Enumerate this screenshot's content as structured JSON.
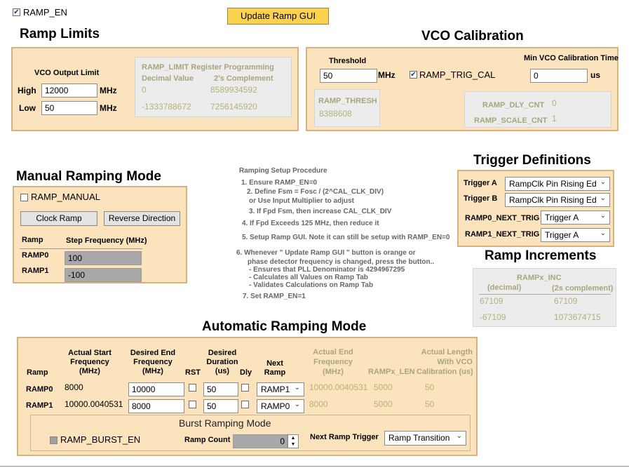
{
  "top": {
    "ramp_en_label": "RAMP_EN",
    "ramp_en_checked": true,
    "update_button": "Update Ramp GUI",
    "update_button_color": "#fbd24e"
  },
  "ramp_limits": {
    "title": "Ramp Limits",
    "vco_output_limit": "VCO Output Limit",
    "high_label": "High",
    "high_value": "12000",
    "low_label": "Low",
    "low_value": "50",
    "unit": "MHz",
    "reg_title": "RAMP_LIMIT Register Programming",
    "decimal_header": "Decimal Value",
    "twos_header": "2's Complement",
    "dec1": "0",
    "twos1": "8589934592",
    "dec2": "-1333788672",
    "twos2": "7256145920"
  },
  "vco_cal": {
    "title": "VCO Calibration",
    "threshold_label": "Threshold",
    "threshold_value": "50",
    "unit": "MHz",
    "trig_cal_label": "RAMP_TRIG_CAL",
    "trig_cal_checked": true,
    "min_time_label": "Min VCO Calibration Time",
    "min_time_value": "0",
    "us": "us",
    "thresh_label": "RAMP_THRESH",
    "thresh_value": "8388608",
    "dly_cnt_label": "RAMP_DLY_CNT",
    "dly_cnt_value": "0",
    "scale_cnt_label": "RAMP_SCALE_CNT",
    "scale_cnt_value": "1"
  },
  "manual": {
    "title": "Manual Ramping Mode",
    "ramp_manual_label": "RAMP_MANUAL",
    "ramp_manual_checked": false,
    "clock_ramp": "Clock Ramp",
    "reverse_direction": "Reverse Direction",
    "col_ramp": "Ramp",
    "col_step": "Step Frequency (MHz)",
    "rows": [
      {
        "name": "RAMP0",
        "value": "100"
      },
      {
        "name": "RAMP1",
        "value": "-100"
      }
    ]
  },
  "procedure": {
    "title": "Ramping Setup Procedure",
    "lines": [
      "1.  Ensure RAMP_EN=0",
      "2.  Define  Fsm = Fosc / (2^CAL_CLK_DIV)",
      "or Use Input Multiplier to adjust",
      "3.  If Fpd   Fsm, then increase CAL_CLK_DIV",
      "4.   If Fpd Exceeds 125 MHz, then reduce it",
      "5.   Setup Ramp GUI.  Note it can still be setup with RAMP_EN=0",
      "6.  Whenever  \" Update Ramp GUI \"  button is orange or",
      "phase detector frequency is changed, press the button..",
      "- Ensures that PLL Denominator is 4294967295",
      "- Calculates all Values on Ramp Tab",
      "- Validates Calculations on Ramp Tab",
      "7.  Set RAMP_EN=1"
    ]
  },
  "triggers": {
    "title": "Trigger Definitions",
    "trigger_a_label": "Trigger A",
    "trigger_a_value": "RampClk Pin Rising Ed",
    "trigger_b_label": "Trigger  B",
    "trigger_b_value": "RampClk Pin Rising Ed",
    "ramp0_next_label": "RAMP0_NEXT_TRIG",
    "ramp0_next_value": "Trigger A",
    "ramp1_next_label": "RAMP1_NEXT_TRIG",
    "ramp1_next_value": "Trigger A"
  },
  "increments": {
    "title": "Ramp Increments",
    "header": "RAMPx_INC",
    "col_dec": "(decimal)",
    "col_twos": "(2s complement)",
    "rows": [
      {
        "dec": "67109",
        "twos": "67109"
      },
      {
        "dec": "-67109",
        "twos": "1073674715"
      }
    ]
  },
  "auto": {
    "title": "Automatic Ramping Mode",
    "headers": {
      "ramp": "Ramp",
      "actual_start": [
        "Actual Start",
        "Frequency",
        "(MHz)"
      ],
      "desired_end": [
        "Desired End",
        "Frequency",
        "(MHz)"
      ],
      "rst": "RST",
      "desired_duration": [
        "Desired",
        "Duration",
        "(us)"
      ],
      "dly": "Dly",
      "next_ramp": [
        "Next",
        "Ramp"
      ],
      "actual_end": [
        "Actual End",
        "Frequency",
        "(MHz)"
      ],
      "len": "RAMPx_LEN",
      "actual_length": [
        "Actual Length",
        "With VCO",
        "Calibration (us)"
      ]
    },
    "rows": [
      {
        "name": "RAMP0",
        "start": "8000",
        "end": "10000",
        "duration": "50",
        "next": "RAMP1",
        "actual_end": "10000.0040531",
        "len": "5000",
        "actual_length": "50"
      },
      {
        "name": "RAMP1",
        "start": "10000.0040531",
        "end": "8000",
        "duration": "50",
        "next": "RAMP0",
        "actual_end": "8000",
        "len": "5000",
        "actual_length": "50"
      }
    ],
    "burst": {
      "title": "Burst Ramping Mode",
      "burst_en_label": "RAMP_BURST_EN",
      "ramp_count_label": "Ramp Count",
      "ramp_count_value": "0",
      "next_trigger_label": "Next Ramp Trigger",
      "next_trigger_value": "Ramp Transition"
    }
  }
}
